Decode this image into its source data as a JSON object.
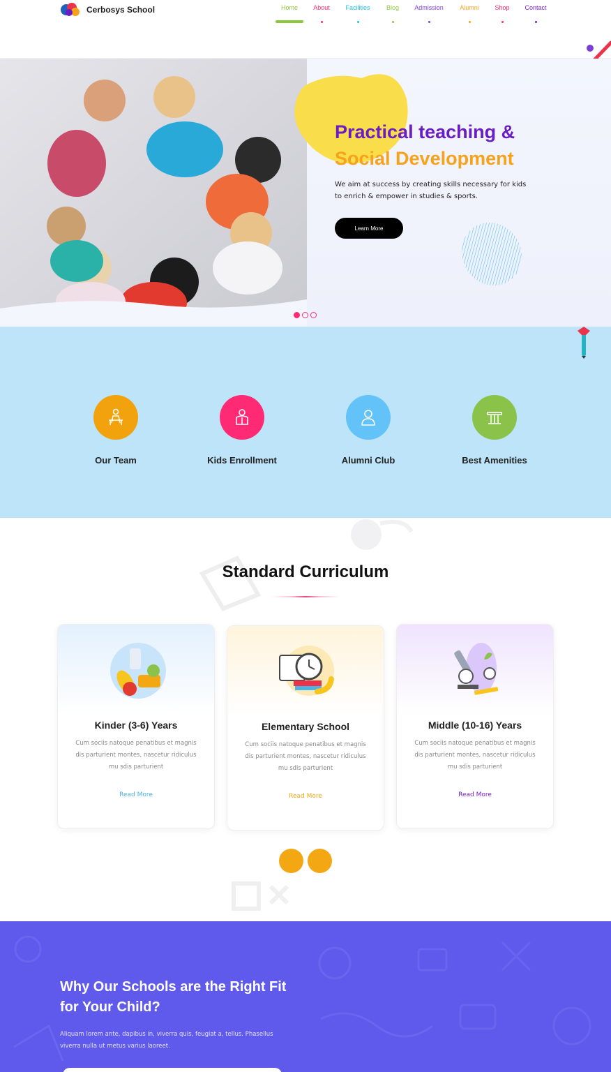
{
  "brand": {
    "name": "Cerbosys School"
  },
  "nav": {
    "items": [
      {
        "label": "Home",
        "color": "#8dc63f",
        "active": true
      },
      {
        "label": "About",
        "color": "#ff2a73"
      },
      {
        "label": "Facilities",
        "color": "#20c2e0"
      },
      {
        "label": "Blog",
        "color": "#8dc63f"
      },
      {
        "label": "Admission",
        "color": "#7b3fe4"
      },
      {
        "label": "Alumni",
        "color": "#f6a21c"
      },
      {
        "label": "Shop",
        "color": "#ff2a73"
      },
      {
        "label": "Contact",
        "color": "#7a1fd0"
      }
    ]
  },
  "hero": {
    "title_line1": "Practical teaching &",
    "title_line2": "Social Development",
    "text": "We aim at success by creating skills necessary for kids to enrich & empower in studies & sports.",
    "button": "Learn More",
    "colors": {
      "title1": "#6a1cc5",
      "title2": "#f6a21c",
      "blob": "#fadd4b"
    }
  },
  "features": [
    {
      "label": "Our Team",
      "color": "#f2a20c",
      "icon": "person-desk-icon"
    },
    {
      "label": "Kids Enrollment",
      "color": "#ff2a73",
      "icon": "student-reading-icon"
    },
    {
      "label": "Alumni Club",
      "color": "#63c2f8",
      "icon": "graduate-icon"
    },
    {
      "label": "Best Amenities",
      "color": "#8bc34a",
      "icon": "pillar-icon"
    }
  ],
  "curriculum": {
    "title": "Standard Curriculum",
    "cards": [
      {
        "title": "Kinder (3-6) Years",
        "desc": "Cum sociis natoque penatibus et magnis dis parturient montes, nascetur ridiculus mu sdis parturient",
        "more": "Read More",
        "accent": "#4ab4e6",
        "bg": "#e3f1fd"
      },
      {
        "title": "Elementary School",
        "desc": "Cum sociis natoque penatibus et magnis dis parturient montes, nascetur ridiculus mu sdis parturient",
        "more": "Read More",
        "accent": "#f3a712",
        "bg": "#fff4dc"
      },
      {
        "title": "Middle (10-16) Years",
        "desc": "Cum sociis natoque penatibus et magnis dis parturient montes, nascetur ridiculus mu sdis parturient",
        "more": "Read More",
        "accent": "#7a1fd0",
        "bg": "#efe4fd"
      }
    ]
  },
  "why": {
    "title": "Why Our Schools are the Right Fit for Your Child?",
    "text": "Aliquam lorem ante, dapibus in, viverra quis, feugiat a, tellus. Phasellus viverra nulla ut metus varius laoreet."
  }
}
